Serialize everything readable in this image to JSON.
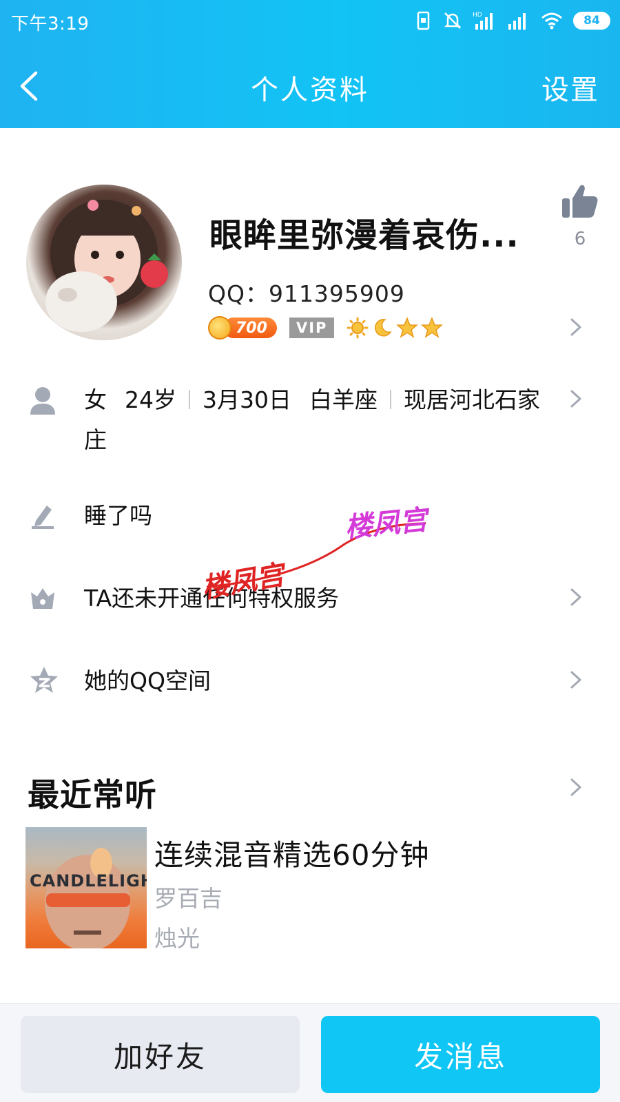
{
  "status_bar": {
    "time": "下午3:19",
    "battery": "84"
  },
  "header": {
    "title": "个人资料",
    "right_label": "设置"
  },
  "profile": {
    "nickname": "眼眸里弥漫着哀伤...",
    "qq_label": "QQ：911395909",
    "level_badge": "700",
    "vip_badge": "VIP",
    "like_count": "6",
    "level_icons": [
      "sun-icon",
      "moon-icon",
      "star-icon",
      "star-icon"
    ]
  },
  "info": {
    "gender": "女",
    "age": "24岁",
    "birthday": "3月30日",
    "zodiac": "白羊座",
    "location_line1": "现居河北石家",
    "location_line2": "庄",
    "signature": "睡了吗",
    "privilege": "TA还未开通任何特权服务",
    "qzone": "她的QQ空间"
  },
  "music": {
    "section_title": "最近常听",
    "song_title": "连续混音精选60分钟",
    "singer": "罗百吉",
    "album": "烛光",
    "cover_text": "CANDLELIGHT"
  },
  "watermark": {
    "text": "楼凤宫"
  },
  "buttons": {
    "add_friend": "加好友",
    "send_message": "发消息"
  },
  "colors": {
    "header": "#12c3f5",
    "primary_button": "#10c6f5",
    "secondary_button": "#e8eaf2",
    "accent_orange": "#f15a10"
  }
}
